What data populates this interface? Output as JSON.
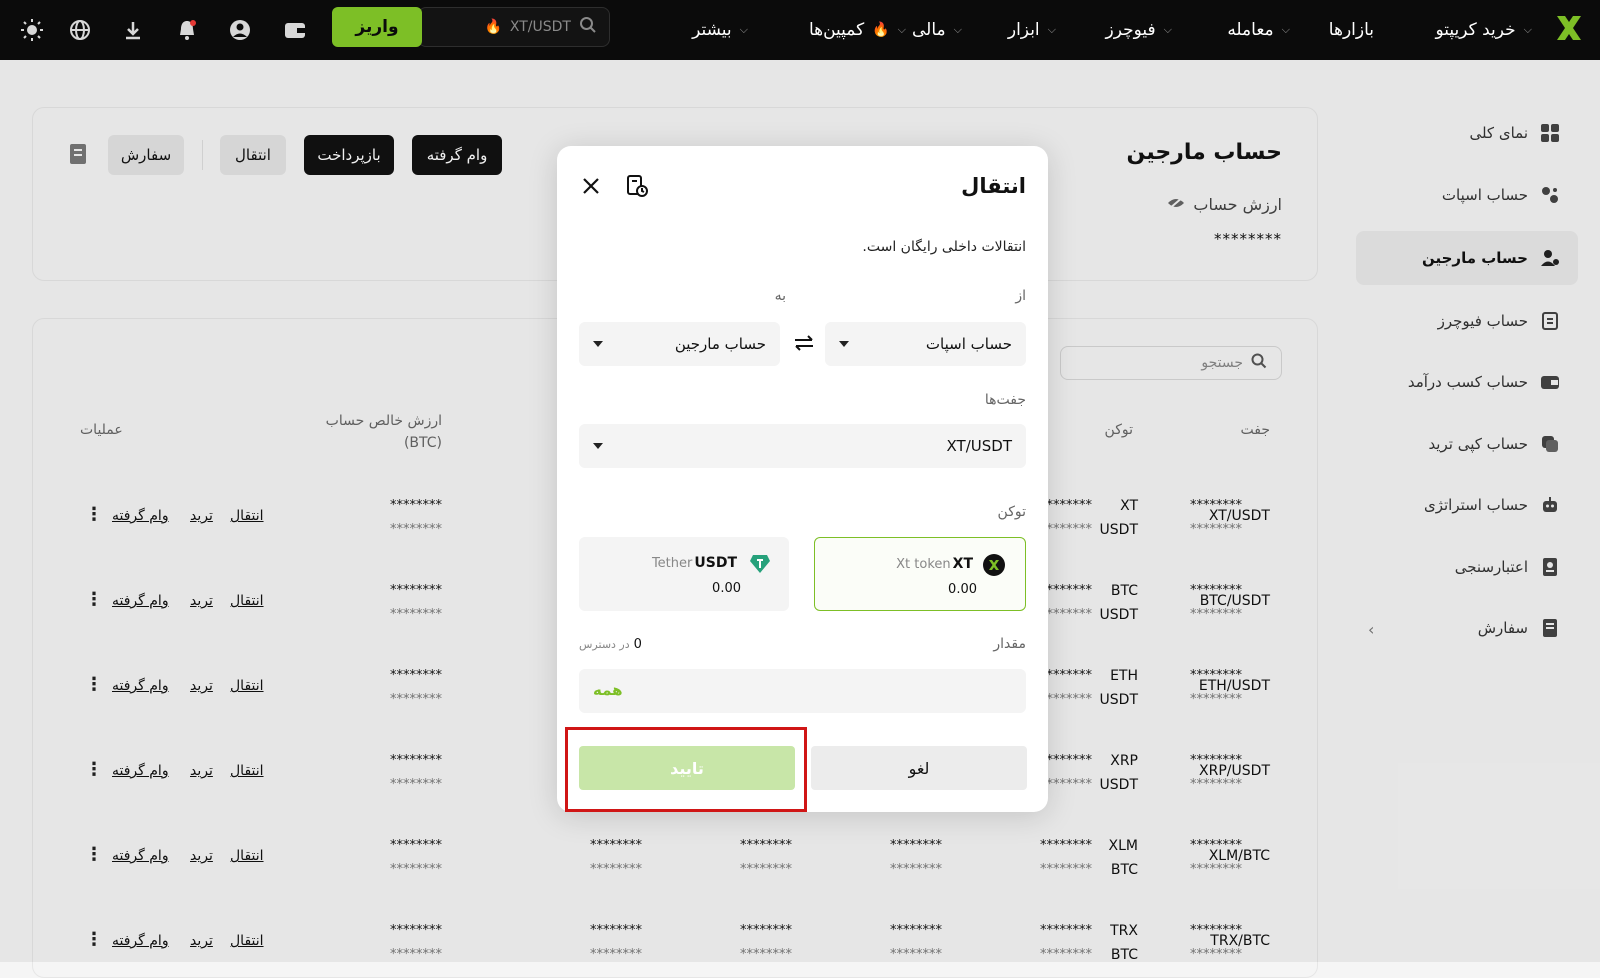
{
  "topnav": {
    "brand_color": "#7dbf26",
    "items": [
      {
        "label": "خرید کریپتو",
        "chevron": true
      },
      {
        "label": "بازارها",
        "chevron": false
      },
      {
        "label": "معامله",
        "chevron": true
      },
      {
        "label": "فیوچرز",
        "chevron": true
      },
      {
        "label": "ابزار",
        "chevron": true
      },
      {
        "label": "مالی",
        "chevron": true
      },
      {
        "label": "کمپین‌ها",
        "chevron": true
      },
      {
        "label": "بیشتر",
        "chevron": true
      }
    ],
    "search_text": "XT/USDT",
    "deposit_label": "واریز",
    "icons": [
      "wallet-icon",
      "user-icon",
      "bell-icon",
      "download-icon",
      "globe-icon",
      "sun-icon"
    ]
  },
  "sidebar": {
    "items": [
      {
        "label": "نمای کلی",
        "icon": "grid-icon"
      },
      {
        "label": "حساب اسپات",
        "icon": "spot-icon"
      },
      {
        "label": "حساب مارجین",
        "icon": "margin-icon",
        "active": true
      },
      {
        "label": "حساب فیوچرز",
        "icon": "futures-icon"
      },
      {
        "label": "حساب کسب درآمد",
        "icon": "earn-icon"
      },
      {
        "label": "حساب کپی ترید",
        "icon": "copy-icon"
      },
      {
        "label": "حساب استراتژی",
        "icon": "robot-icon"
      },
      {
        "label": "اعتبارسنجی",
        "icon": "id-icon"
      },
      {
        "label": "سفارش",
        "icon": "order-icon"
      }
    ]
  },
  "header_card": {
    "title": "حساب مارجین",
    "account_value_label": "ارزش حساب",
    "account_value": "********",
    "buttons": {
      "borrow": "وام گرفته",
      "repay": "بازپرداخت",
      "transfer": "انتقال",
      "order": "سفارش"
    }
  },
  "table": {
    "search_placeholder": "جستجو",
    "headers": {
      "pair": "جفت",
      "token": "توکن",
      "net_value": "ارزش خالص حساب (BTC)",
      "ops": "عملیات"
    },
    "rows": [
      {
        "pair": "XT/USDT",
        "token1": "XT",
        "token2": "USDT"
      },
      {
        "pair": "BTC/USDT",
        "token1": "BTC",
        "token2": "USDT"
      },
      {
        "pair": "ETH/USDT",
        "token1": "ETH",
        "token2": "USDT"
      },
      {
        "pair": "XRP/USDT",
        "token1": "XRP",
        "token2": "USDT"
      },
      {
        "pair": "XLM/BTC",
        "token1": "XLM",
        "token2": "BTC"
      },
      {
        "pair": "TRX/BTC",
        "token1": "TRX",
        "token2": "BTC"
      }
    ],
    "mask": "********",
    "ops": {
      "transfer": "انتقال",
      "trade": "ترید",
      "borrow": "وام گرفته"
    }
  },
  "modal": {
    "title": "انتقال",
    "subtitle": "انتقالات داخلی رایگان است.",
    "from_label": "از",
    "to_label": "به",
    "from_value": "حساب اسپات",
    "to_value": "حساب مارجین",
    "pairs_label": "جفت‌ها",
    "pairs_value": "XT/USDT",
    "token_label": "توکن",
    "tokens": [
      {
        "symbol": "XT",
        "name": "Xt token",
        "amount": "0.00",
        "selected": true
      },
      {
        "symbol": "USDT",
        "name": "Tether",
        "amount": "0.00",
        "selected": false
      }
    ],
    "amount_label": "مقدار",
    "available_value": "0",
    "available_label": "در دسترس",
    "all_label": "همه",
    "confirm_label": "تایید",
    "cancel_label": "لغو"
  }
}
